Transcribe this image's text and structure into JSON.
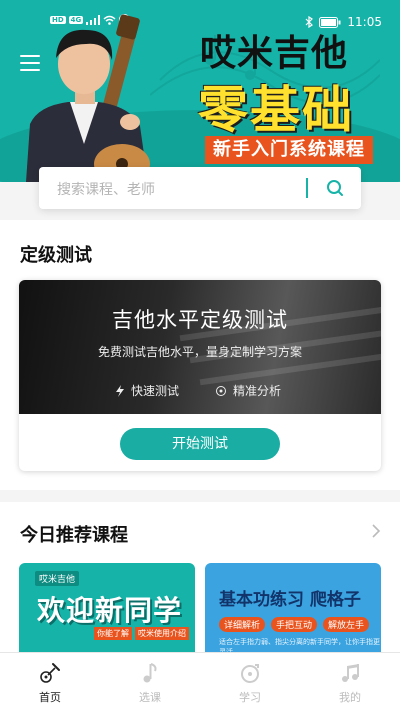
{
  "status_bar": {
    "left_chips": [
      "HD",
      "4G"
    ],
    "time": "11:05"
  },
  "banner": {
    "title_line1": "哎米吉他",
    "title_line2": "零基础",
    "badge": "新手入门系统课程"
  },
  "search": {
    "placeholder": "搜索课程、老师"
  },
  "placement": {
    "section_title": "定级测试",
    "card_title": "吉他水平定级测试",
    "card_subtitle": "免费测试吉他水平，量身定制学习方案",
    "features": [
      "快速测试",
      "精准分析"
    ],
    "button_label": "开始测试"
  },
  "recommend": {
    "section_title": "今日推荐课程",
    "courses": [
      {
        "logo_tag": "哎米吉他",
        "title": "欢迎新同学",
        "tags": [
          "你能了解",
          "哎米使用介绍"
        ]
      },
      {
        "title": "基本功练习 爬格子",
        "tags": [
          "详细解析",
          "手把互动",
          "解放左手"
        ],
        "note": "适合左手指力弱、指尖分离的新手同学，让你手指更灵活"
      }
    ]
  },
  "bottom_nav": {
    "items": [
      {
        "label": "首页",
        "icon": "guitar-icon",
        "active": true
      },
      {
        "label": "选课",
        "icon": "music-note-icon",
        "active": false
      },
      {
        "label": "学习",
        "icon": "study-icon",
        "active": false
      },
      {
        "label": "我的",
        "icon": "double-note-icon",
        "active": false
      }
    ]
  },
  "colors": {
    "brand_teal": "#16b3a8",
    "banner_yellow": "#ffe12e",
    "accent_orange": "#e9541e"
  }
}
